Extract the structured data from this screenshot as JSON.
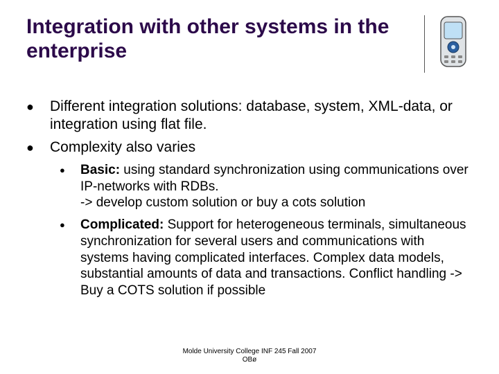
{
  "title": "Integration with other systems in the enterprise",
  "bullets": [
    {
      "text": "Different integration solutions: database, system, XML-data, or integration using flat file."
    },
    {
      "text": "Complexity also varies"
    }
  ],
  "sub_bullets": [
    {
      "label": "Basic:",
      "text": " using standard synchronization using communications over IP-networks with RDBs.\n-> develop custom solution or buy a cots solution"
    },
    {
      "label": "Complicated:",
      "text": " Support for heterogeneous terminals, simultaneous synchronization for several users and communications with systems having complicated interfaces. Complex data models, substantial amounts of data and transactions. Conflict handling -> Buy a COTS solution if possible"
    }
  ],
  "footer": {
    "line1": "Molde University College INF 245 Fall 2007",
    "line2": "OBø"
  },
  "icon_name": "mobile-phone-icon"
}
